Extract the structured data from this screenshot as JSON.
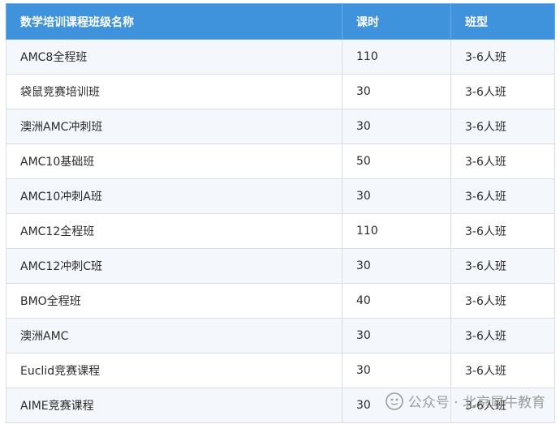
{
  "table": {
    "headers": [
      "数学培训课程班级名称",
      "课时",
      "班型"
    ],
    "rows": [
      [
        "AMC8全程班",
        "110",
        "3-6人班"
      ],
      [
        "袋鼠竞赛培训班",
        "30",
        "3-6人班"
      ],
      [
        "澳洲AMC冲刺班",
        "30",
        "3-6人班"
      ],
      [
        "AMC10基础班",
        "50",
        "3-6人班"
      ],
      [
        "AMC10冲刺A班",
        "30",
        "3-6人班"
      ],
      [
        "AMC12全程班",
        "110",
        "3-6人班"
      ],
      [
        "AMC12冲刺C班",
        "30",
        "3-6人班"
      ],
      [
        "BMO全程班",
        "40",
        "3-6人班"
      ],
      [
        "澳洲AMC",
        "30",
        "3-6人班"
      ],
      [
        "Euclid竞赛课程",
        "30",
        "3-6人班"
      ],
      [
        "AIME竞赛课程",
        "30",
        "3-6人班"
      ]
    ]
  },
  "watermark": {
    "text": "公众号 · 北京犀牛教育",
    "icon": "wechat-official-account-icon"
  },
  "colors": {
    "header_bg": "#3f92dc",
    "header_text": "#ffffff",
    "row_alt_bg": "#f4f7fb",
    "border": "#d9dee5"
  }
}
